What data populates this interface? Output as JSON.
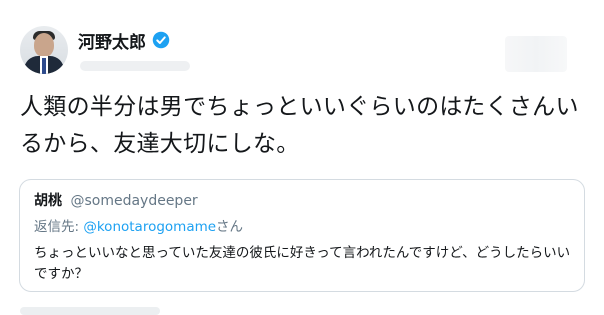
{
  "author": {
    "display_name": "河野太郎",
    "verified": true
  },
  "tweet": {
    "text": "人類の半分は男でちょっといいぐらいのはたくさんいるから、友達大切にしな。"
  },
  "quoted_tweet": {
    "display_name": "胡桃",
    "handle": "@somedaydeeper",
    "reply_prefix": "返信先: ",
    "reply_target": "@konotarogomame",
    "reply_suffix": "さん",
    "text": "ちょっといいなと思っていた友達の彼氏に好きって言われたんですけど、どうしたらいいですか？"
  },
  "colors": {
    "accent": "#1da1f2",
    "text_primary": "#14171a",
    "text_secondary": "#657786",
    "border": "#d4dbe1"
  },
  "icons": {
    "verified": "verified-badge-icon"
  }
}
